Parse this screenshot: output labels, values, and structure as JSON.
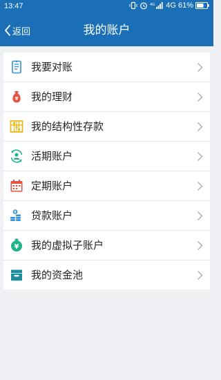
{
  "status_bar": {
    "time": "13:47",
    "network": "4G",
    "battery": "61%"
  },
  "header": {
    "back_label": "返回",
    "title": "我的账户"
  },
  "menu": [
    {
      "label": "我要对账",
      "icon": "checklist-icon"
    },
    {
      "label": "我的理财",
      "icon": "money-bag-icon"
    },
    {
      "label": "我的结构性存款",
      "icon": "abacus-icon"
    },
    {
      "label": "活期账户",
      "icon": "person-cycle-icon"
    },
    {
      "label": "定期账户",
      "icon": "calendar-icon"
    },
    {
      "label": "贷款账户",
      "icon": "coin-stack-icon"
    },
    {
      "label": "我的虚拟子账户",
      "icon": "yen-coin-icon"
    },
    {
      "label": "我的资金池",
      "icon": "inbox-box-icon"
    }
  ],
  "colors": {
    "header_bg": "#1a6fb6",
    "page_bg": "#eef0f3",
    "icon_blue": "#2f8fd8",
    "icon_red": "#e25546",
    "icon_yellow": "#e8b819",
    "icon_green": "#21b38a",
    "icon_teal": "#1f8c9c"
  }
}
